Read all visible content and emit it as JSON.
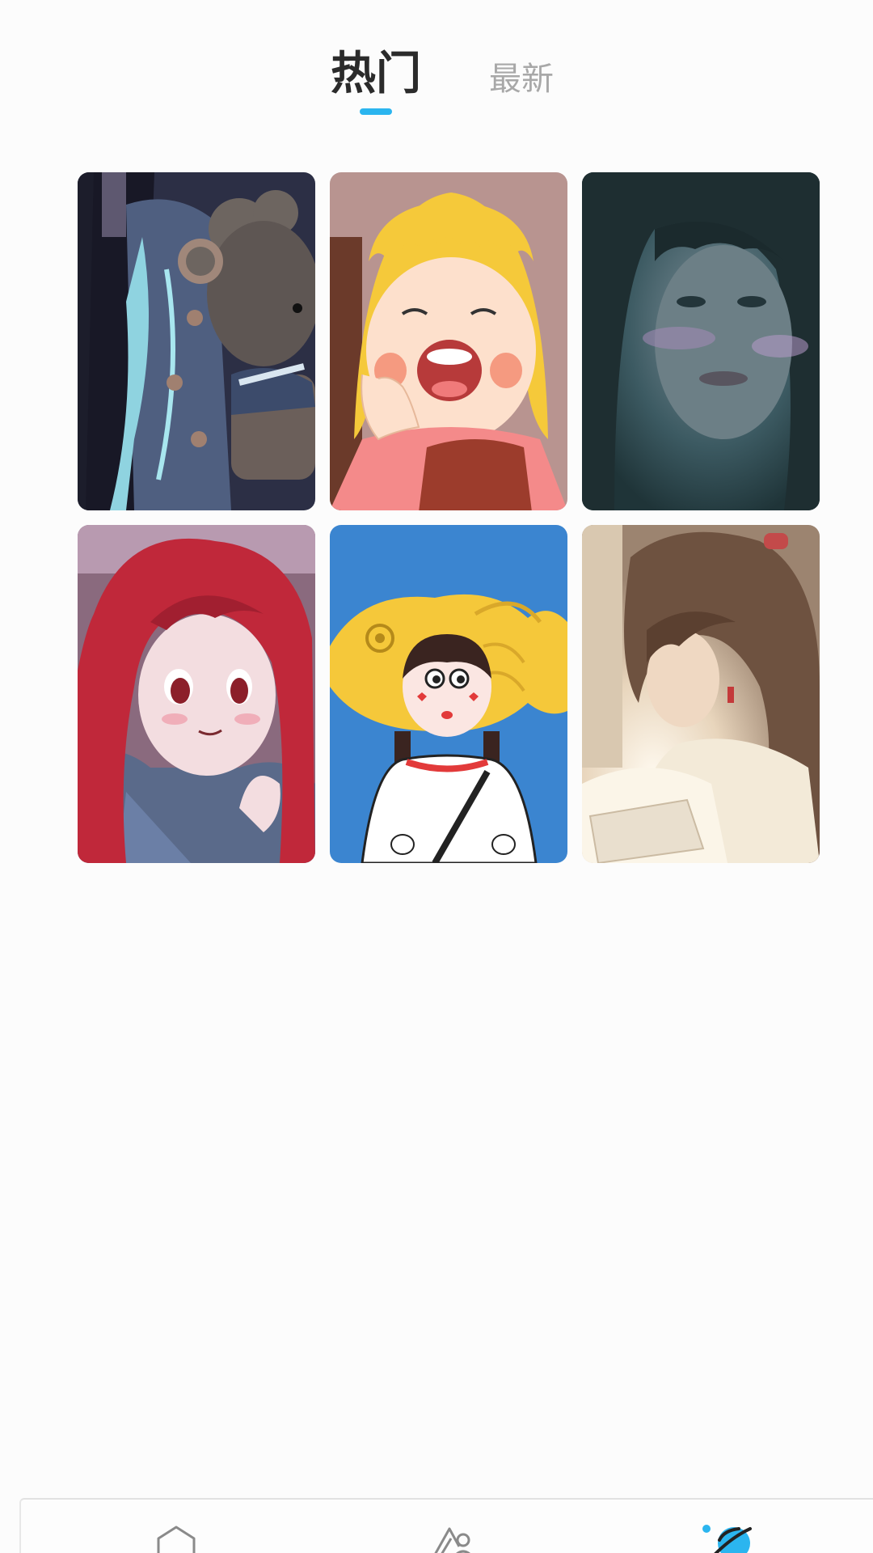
{
  "tabs": [
    {
      "label": "热门",
      "active": true
    },
    {
      "label": "最新",
      "active": false
    }
  ],
  "colors": {
    "accent": "#2bb5ef",
    "active_tab_text": "#2b2b2b",
    "inactive_tab_text": "#a8a8a8",
    "background": "#fcfcfc"
  },
  "grid": {
    "items": [
      {
        "image": "anime-girl-with-teddy-bear"
      },
      {
        "image": "cartoon-blonde-girl-yawning"
      },
      {
        "image": "girl-portrait-dark-teal"
      },
      {
        "image": "anime-red-haired-girl"
      },
      {
        "image": "cartoon-girl-in-fish-hat"
      },
      {
        "image": "girl-reading-warm-light"
      }
    ]
  },
  "bottom_nav": {
    "items": [
      {
        "icon": "home-icon",
        "active": false
      },
      {
        "icon": "create-icon",
        "active": false
      },
      {
        "icon": "planet-icon",
        "active": true
      }
    ]
  }
}
